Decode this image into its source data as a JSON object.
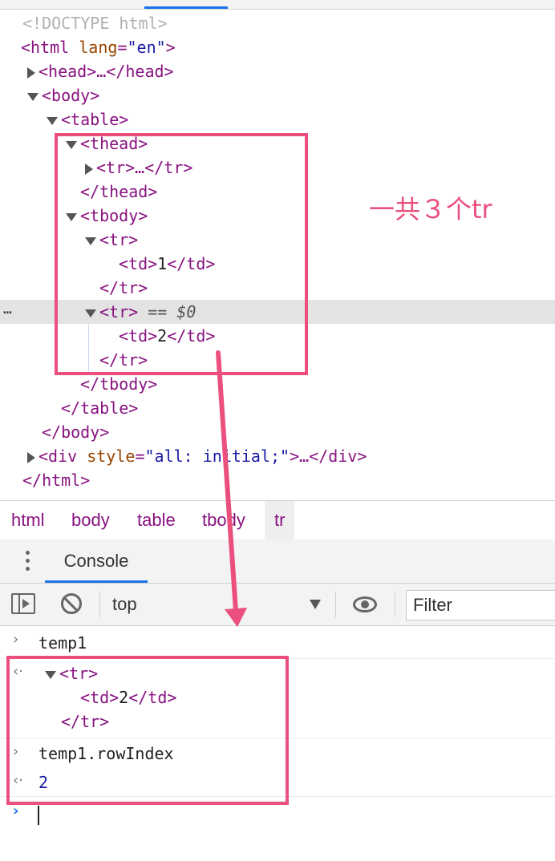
{
  "elements_tree": {
    "doctype": "<!DOCTYPE html>",
    "html_open": "<html",
    "html_attr_name": "lang",
    "html_attr_value": "\"en\"",
    "html_close_bracket": ">",
    "head_collapsed": "<head>…</head>",
    "body_open": "<body>",
    "table_open": "<table>",
    "thead_open": "<thead>",
    "thead_tr_collapsed": "<tr>…</tr>",
    "thead_close": "</thead>",
    "tbody_open": "<tbody>",
    "tr1_open": "<tr>",
    "td1_open": "<td>",
    "td1_text": "1",
    "td1_close": "</td>",
    "tr1_close": "</tr>",
    "tr2_open": "<tr>",
    "tr2_selected_marker": " == $0",
    "td2_open": "<td>",
    "td2_text": "2",
    "td2_close": "</td>",
    "tr2_close": "</tr>",
    "tbody_close": "</tbody>",
    "table_close": "</table>",
    "body_close": "</body>",
    "div_open": "<div",
    "div_attr_name": "style",
    "div_attr_eq": "=",
    "div_attr_value": "\"all: initial;\"",
    "div_rest": ">…</div>",
    "html_close": "</html>",
    "selected_row_dots": "…"
  },
  "breadcrumbs": [
    "html",
    "body",
    "table",
    "tbody",
    "tr"
  ],
  "drawer": {
    "console_tab": "Console"
  },
  "toolbar": {
    "context": "top",
    "filter_placeholder": "Filter"
  },
  "console": {
    "cmd1": "temp1",
    "result1_tr_open": "<tr>",
    "result1_td_open": "<td>",
    "result1_td_text": "2",
    "result1_td_close": "</td>",
    "result1_tr_close": "</tr>",
    "cmd2": "temp1.rowIndex",
    "result2": "2",
    "input_prompt": "›",
    "output_prompt": "‹·",
    "input_history_prompt": "›"
  },
  "annotation": {
    "text": "一共３个tr",
    "color": "#ea4f7e"
  },
  "colors": {
    "tag": "#881280",
    "attr_name": "#994500",
    "attr_value": "#1a1aa6",
    "selection": "#e3e3e3",
    "accent": "#1a73e8"
  },
  "icons": [
    "expand-triangle-icon",
    "collapse-triangle-icon",
    "kebab-menu-icon",
    "sidebar-toggle-icon",
    "clear-console-icon",
    "dropdown-caret-icon",
    "eye-icon",
    "prompt-chevron-icon",
    "result-chevron-icon"
  ]
}
